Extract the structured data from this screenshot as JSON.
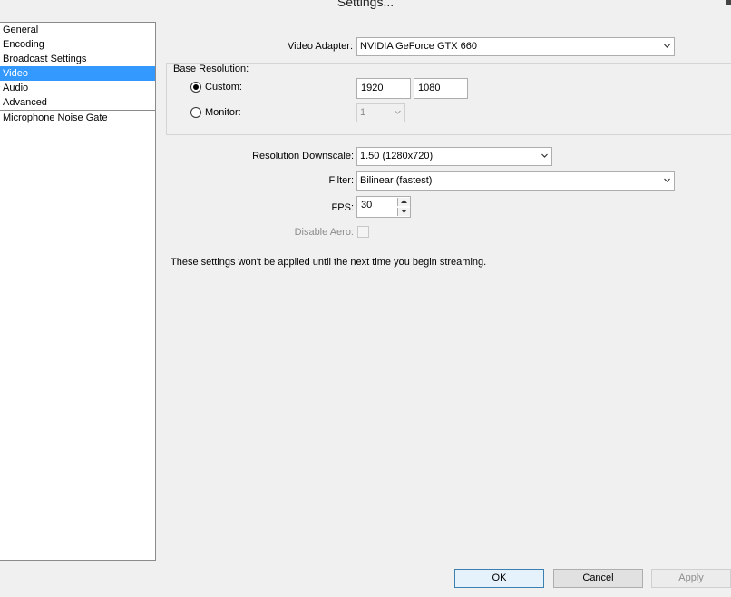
{
  "window": {
    "title": "Settings..."
  },
  "sidebar": {
    "items": [
      {
        "label": "General",
        "selected": false
      },
      {
        "label": "Encoding",
        "selected": false
      },
      {
        "label": "Broadcast Settings",
        "selected": false
      },
      {
        "label": "Video",
        "selected": true
      },
      {
        "label": "Audio",
        "selected": false
      },
      {
        "label": "Advanced",
        "selected": false
      }
    ],
    "plugins": [
      {
        "label": "Microphone Noise Gate"
      }
    ]
  },
  "video": {
    "adapter_label": "Video Adapter:",
    "adapter_value": "NVIDIA GeForce GTX 660",
    "base_resolution_label": "Base Resolution:",
    "custom_label": "Custom:",
    "custom_selected": true,
    "custom_width": "1920",
    "custom_height": "1080",
    "monitor_label": "Monitor:",
    "monitor_selected": false,
    "monitor_value": "1",
    "downscale_label": "Resolution Downscale:",
    "downscale_value": "1.50  (1280x720)",
    "filter_label": "Filter:",
    "filter_value": "Bilinear (fastest)",
    "fps_label": "FPS:",
    "fps_value": "30",
    "disable_aero_label": "Disable Aero:",
    "disable_aero_checked": false,
    "note": "These settings won't be applied until the next time you begin streaming."
  },
  "buttons": {
    "ok": "OK",
    "cancel": "Cancel",
    "apply": "Apply"
  }
}
